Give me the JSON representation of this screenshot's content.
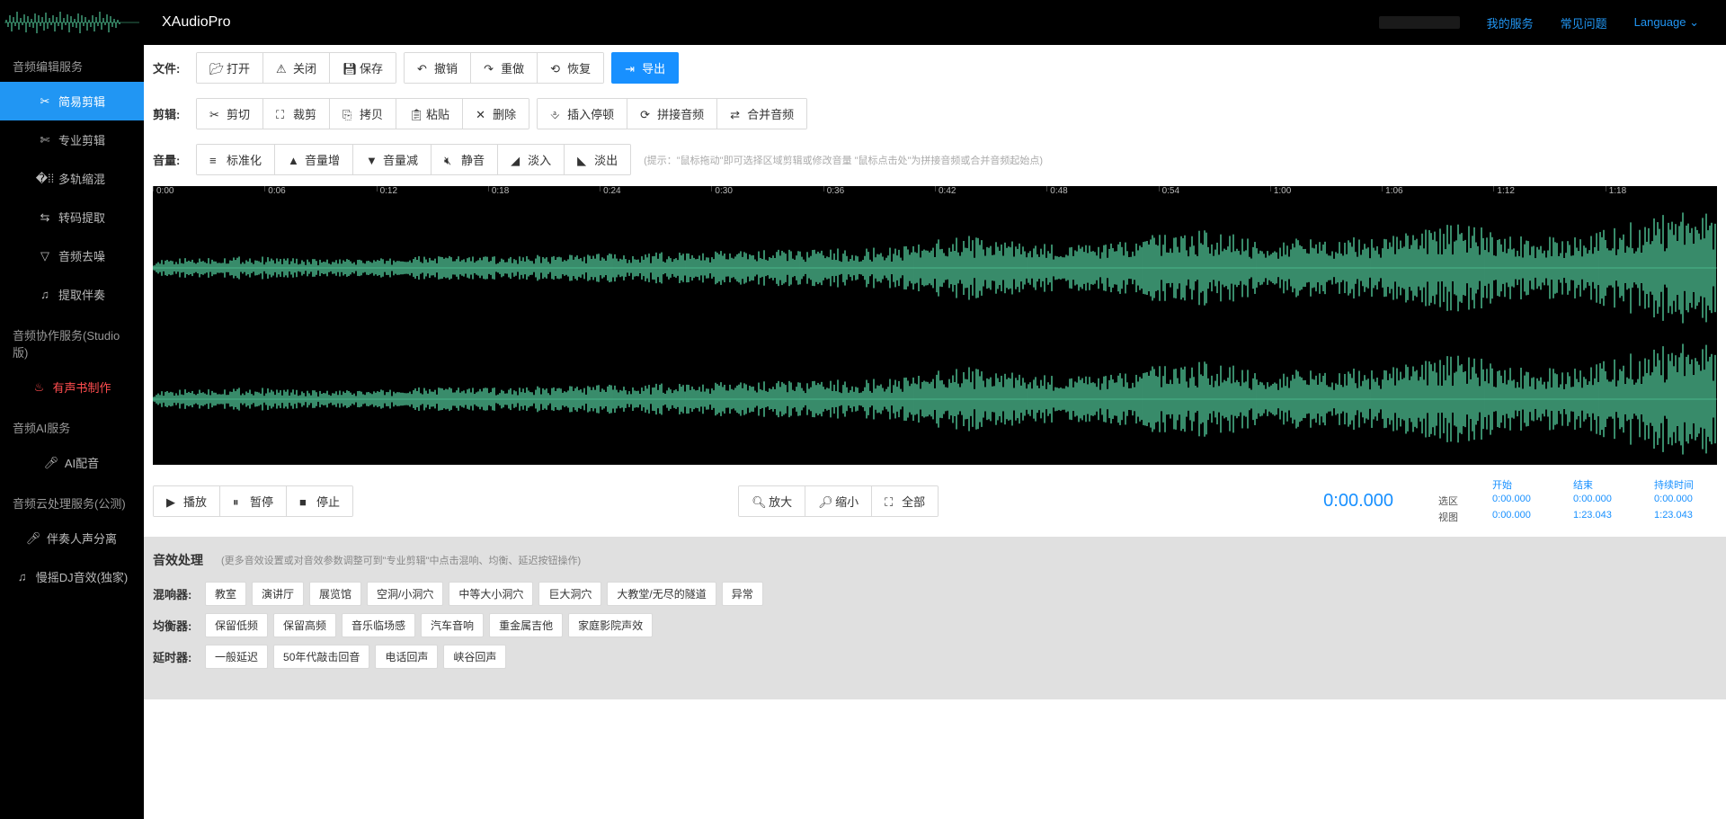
{
  "header": {
    "app_name": "XAudioPro",
    "my_service": "我的服务",
    "faq": "常见问题",
    "language": "Language",
    "chevron": "⌄"
  },
  "sidebar": {
    "section_edit": "音频编辑服务",
    "items_edit": [
      "简易剪辑",
      "专业剪辑",
      "多轨缩混",
      "转码提取",
      "音频去噪",
      "提取伴奏"
    ],
    "section_studio": "音频协作服务(Studio版)",
    "items_studio": [
      "有声书制作"
    ],
    "section_ai": "音频AI服务",
    "items_ai": [
      "AI配音"
    ],
    "section_cloud": "音频云处理服务(公测)",
    "items_cloud": [
      "伴奏人声分离",
      "慢摇DJ音效(独家)"
    ]
  },
  "toolbar": {
    "file_label": "文件:",
    "open": "打开",
    "close": "关闭",
    "save": "保存",
    "undo": "撤销",
    "redo": "重做",
    "restore": "恢复",
    "export": "导出",
    "edit_label": "剪辑:",
    "cut": "剪切",
    "trim": "裁剪",
    "copy": "拷贝",
    "paste": "粘贴",
    "delete": "删除",
    "insert_pause": "插入停顿",
    "concat_audio": "拼接音频",
    "merge_audio": "合并音频",
    "volume_label": "音量:",
    "normalize": "标准化",
    "vol_up": "音量增",
    "vol_down": "音量减",
    "mute": "静音",
    "fade_in": "淡入",
    "fade_out": "淡出",
    "tip": "(提示：\"鼠标拖动\"即可选择区域剪辑或修改音量 \"鼠标点击处\"为拼接音频或合并音频起始点)"
  },
  "ruler": [
    "0:00",
    "0:06",
    "0:12",
    "0:18",
    "0:24",
    "0:30",
    "0:36",
    "0:42",
    "0:48",
    "0:54",
    "1:00",
    "1:06",
    "1:12",
    "1:18"
  ],
  "playback": {
    "play": "播放",
    "pause": "暂停",
    "stop": "停止",
    "zoom_in": "放大",
    "zoom_out": "缩小",
    "all": "全部",
    "current_time": "0:00.000",
    "col_start": "开始",
    "col_end": "结束",
    "col_duration": "持续时间",
    "row_sel": "选区",
    "row_view": "视图",
    "sel_start": "0:00.000",
    "sel_end": "0:00.000",
    "sel_dur": "0:00.000",
    "view_start": "0:00.000",
    "view_end": "1:23.043",
    "view_dur": "1:23.043"
  },
  "fx": {
    "title": "音效处理",
    "tip": "(更多音效设置或对音效参数调整可到\"专业剪辑\"中点击混响、均衡、延迟按钮操作)",
    "reverb_label": "混响器:",
    "reverb": [
      "教室",
      "演讲厅",
      "展览馆",
      "空洞/小洞穴",
      "中等大小洞穴",
      "巨大洞穴",
      "大教堂/无尽的隧道",
      "异常"
    ],
    "eq_label": "均衡器:",
    "eq": [
      "保留低频",
      "保留高频",
      "音乐临场感",
      "汽车音响",
      "重金属吉他",
      "家庭影院声效"
    ],
    "delay_label": "延时器:",
    "delay": [
      "一般延迟",
      "50年代敲击回音",
      "电话回声",
      "峡谷回声"
    ]
  }
}
